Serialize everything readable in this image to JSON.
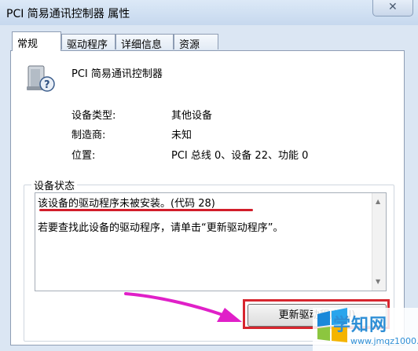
{
  "window": {
    "title": "PCI 简易通讯控制器 属性",
    "close_label": "✕"
  },
  "tabs": [
    {
      "label": "常规",
      "active": true
    },
    {
      "label": "驱动程序",
      "active": false
    },
    {
      "label": "详细信息",
      "active": false
    },
    {
      "label": "资源",
      "active": false
    }
  ],
  "device": {
    "icon": "device-unknown-icon",
    "name": "PCI 简易通讯控制器"
  },
  "properties": [
    {
      "label": "设备类型:",
      "value": "其他设备"
    },
    {
      "label": "制造商:",
      "value": "未知"
    },
    {
      "label": "位置:",
      "value": "PCI 总线 0、设备 22、功能 0"
    }
  ],
  "status": {
    "group_label": "设备状态",
    "line1": "该设备的驱动程序未被安装。(代码 28)",
    "line2": "若要查找此设备的驱动程序，请单击“更新驱动程序”。"
  },
  "update_button": {
    "label": "更新驱动程序(U)"
  },
  "annotations": {
    "highlight_color": "#d7262e",
    "arrow_color": "#e020c8"
  },
  "watermark": {
    "title": "学知网",
    "url": "www.jmqz1000.com"
  }
}
